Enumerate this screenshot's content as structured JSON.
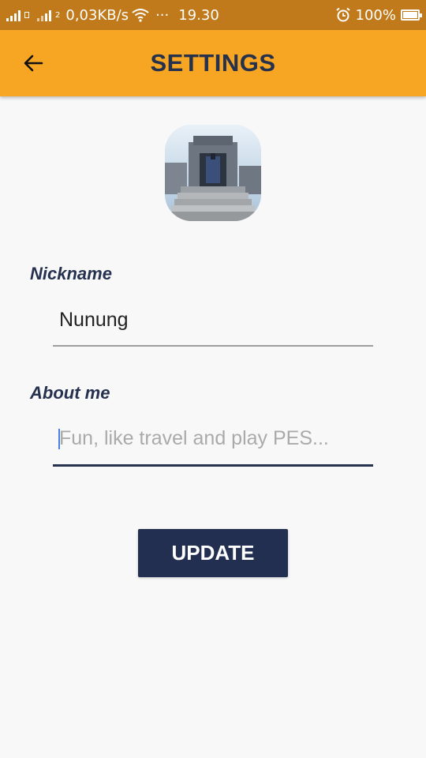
{
  "status_bar": {
    "network_speed": "0,03KB/s",
    "more": "···",
    "time": "19.30",
    "battery_percent": "100%",
    "battery_level": 1.0,
    "sim_label": "2"
  },
  "app_bar": {
    "title": "SETTINGS",
    "back_icon": "arrow-back-icon"
  },
  "profile": {
    "avatar_icon": "profile-photo-temple"
  },
  "form": {
    "nickname_label": "Nickname",
    "nickname_value": "Nunung",
    "about_label": "About me",
    "about_placeholder": "Fun, like travel and play PES...",
    "about_value": ""
  },
  "actions": {
    "update_label": "UPDATE"
  },
  "colors": {
    "app_bar": "#f6a623",
    "status_bar": "#c17a1b",
    "primary_dark": "#25314e",
    "button": "#222f51",
    "background": "#f8f8f8"
  }
}
